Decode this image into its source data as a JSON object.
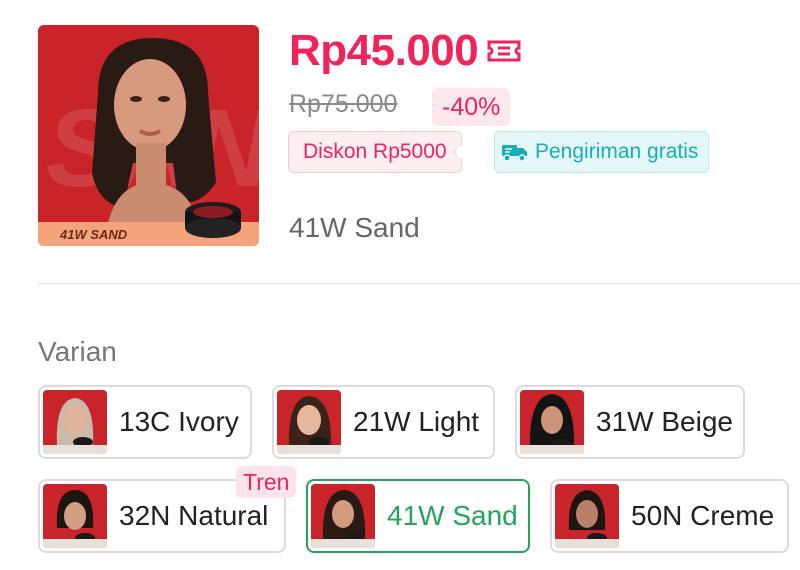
{
  "product": {
    "image_caption": "41W SAND",
    "price": "Rp45.000",
    "original_price": "Rp75.000",
    "discount_percent": "-40%",
    "tags": {
      "discount": "Diskon Rp5000",
      "shipping": "Pengiriman gratis"
    },
    "selected_variant": "41W Sand",
    "icons": {
      "coupon": "ticket-icon",
      "shipping": "truck-icon"
    },
    "colors": {
      "price": "#f0245a",
      "shipping": "#18aeb4",
      "selected": "#23a55a",
      "thumb_bg": "#c8242a"
    }
  },
  "variants": {
    "title": "Varian",
    "trend_badge": "Tren",
    "items": [
      {
        "label": "13C Ivory",
        "selected": false
      },
      {
        "label": "21W Light",
        "selected": false
      },
      {
        "label": "31W Beige",
        "selected": false
      },
      {
        "label": "32N Natural",
        "selected": false
      },
      {
        "label": "41W Sand",
        "selected": true
      },
      {
        "label": "50N Creme",
        "selected": false
      }
    ]
  }
}
